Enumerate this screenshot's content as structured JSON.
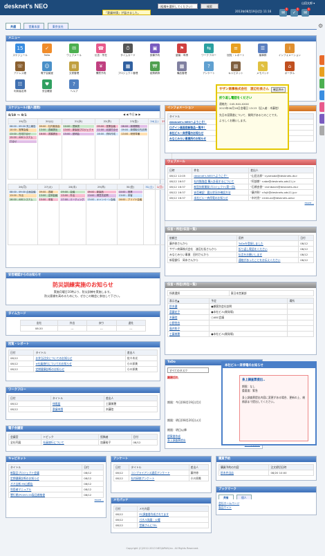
{
  "app": {
    "logo": "desknet's NEO",
    "notice": "「稟議申請」が届きました。",
    "search_placeholder": "(組織を選択してください)",
    "search_button": "検索",
    "datetime": "2013年08月19日(月) 11:16",
    "user": "山田太郎 ▾"
  },
  "top_badges": [
    "1",
    "1",
    "1"
  ],
  "tabs": [
    "共通",
    "営業本部",
    "東京支社"
  ],
  "menu": {
    "title": "メニュー",
    "items": [
      {
        "label": "スケジュール",
        "color": "#3a8de0",
        "glyph": "15"
      },
      {
        "label": "ToDo",
        "color": "#f08c2a",
        "glyph": "✓"
      },
      {
        "label": "ウェブメール",
        "color": "#4caf50",
        "glyph": "✉"
      },
      {
        "label": "伝言・所在",
        "color": "#e85a8c",
        "glyph": "☎"
      },
      {
        "label": "タイムカード",
        "color": "#555",
        "glyph": "⏱"
      },
      {
        "label": "設備予約",
        "color": "#7a5cc0",
        "glyph": "▣"
      },
      {
        "label": "稟議・申請",
        "color": "#d04040",
        "glyph": "⚑"
      },
      {
        "label": "ワークフロー",
        "color": "#2aa0a0",
        "glyph": "⇆"
      },
      {
        "label": "回覧・レポート",
        "color": "#e8a020",
        "glyph": "≡"
      },
      {
        "label": "議事録",
        "color": "#5a7fc0",
        "glyph": "☰"
      },
      {
        "label": "インフォメーション",
        "color": "#e09030",
        "glyph": "i"
      },
      {
        "label": "アドレス帳",
        "color": "#8a6030",
        "glyph": "☏"
      },
      {
        "label": "電子会議室",
        "color": "#4a90c8",
        "glyph": "☺"
      },
      {
        "label": "文書管理",
        "color": "#c0a040",
        "glyph": "▤"
      },
      {
        "label": "購買予約",
        "color": "#c04080",
        "glyph": "¥"
      },
      {
        "label": "プロジェクト管理",
        "color": "#3060a0",
        "glyph": "▦"
      },
      {
        "label": "経費精算",
        "color": "#50a050",
        "glyph": "₩"
      },
      {
        "label": "備品管理",
        "color": "#8080a0",
        "glyph": "▩"
      },
      {
        "label": "アンケート",
        "color": "#60a0d0",
        "glyph": "?"
      },
      {
        "label": "キャビネット",
        "color": "#806040",
        "glyph": "▥"
      },
      {
        "label": "メモパッド",
        "color": "#e0c040",
        "glyph": "✎"
      },
      {
        "label": "ポータル",
        "color": "#c05020",
        "glyph": "⌂"
      },
      {
        "label": "利用者名簿",
        "color": "#4070b0",
        "glyph": "☷"
      },
      {
        "label": "安否確認",
        "color": "#30a060",
        "glyph": "♥"
      },
      {
        "label": "ヘルプ",
        "color": "#5080c0",
        "glyph": "?"
      }
    ]
  },
  "schedule": {
    "title": "スケジュール(個人週間)",
    "range": "8/19 ～ 9/1",
    "week1_dates": [
      "19(月)",
      "20(火)",
      "21(水)",
      "22(木)",
      "23(金)",
      "24(土)",
      "25(日)"
    ],
    "week2_dates": [
      "26(月)",
      "27(火)",
      "28(水)",
      "29(木)",
      "30(金)",
      "31(土)",
      "1(日)"
    ],
    "w1": [
      [
        "08:00 - 09:00 売上報告",
        "10:00 - 営業会議",
        "13:00 - 在宅打合せ",
        "15:00 - ABCシステム",
        "打合せ"
      ],
      [
        "09:00 - 社内勉強会",
        "13:00 - 週報提出",
        "16:00 - 書類提出"
      ],
      [
        "10:00 - 提案書",
        "13:00 - 新製品プロジェクト",
        "15:00 - 説明会"
      ],
      [
        "09:00 - 営業会議",
        "11:00 - 北部打合せ",
        "16:00 - 資料作成"
      ],
      [
        "08:00 - 新規開拓",
        "09:00 - 新規取引先訪問",
        "13:00 - 研修準備"
      ],
      [],
      []
    ],
    "w2": [
      [
        "08:00 - 09:00 企画会議",
        "13:00 - 外出",
        "16:00 - ABCシステム"
      ],
      [
        "09:00 - 週報",
        "13:00 - 定例会議",
        "15:00 - 来客"
      ],
      [
        "09:00 - 会議",
        "13:00 - 外出",
        "17:00 - ミーティング"
      ],
      [
        "09:00 - 新製品",
        "13:00 - 得意先訪問",
        "15:00 - キャンペーン会議"
      ],
      [
        "10:00 - 営業",
        "13:00 - 来客",
        "16:00 - アリゾナ会議"
      ],
      [],
      []
    ]
  },
  "information": {
    "title": "インフォメーション",
    "col_title": "タイトル",
    "items": [
      [
        "desknet's NEOへようこそ！",
        ""
      ],
      [
        "ログイン画面用新製品一覧中！",
        ""
      ],
      [
        "本社ビル一斉停電のお知らせ",
        ""
      ],
      [
        "みなとみらい事業所のお知らせ",
        "小川(総務)[人事検査部]"
      ]
    ]
  },
  "popup": {
    "title": "サザン商事株式会社　渡辺社長さん",
    "button": "確認済み",
    "alert": "折り返し電話をください",
    "phone": "連絡先：045-940-XXXX",
    "detail": "2013年08月16日金曜日 13:23（記入者：木藤陸）",
    "body": "先日の見積書について、質問があるとのことです。",
    "body2": "よろしくお願いします。"
  },
  "webmail": {
    "title": "ウェブメール",
    "headers": [
      "日時",
      "件名",
      "差出人"
    ],
    "rows": [
      [
        "08/12 12:05",
        "desknet's NEOへようこそ！",
        "\"山田太郎\" <yamada@desknets.ds>"
      ],
      [
        "08/12 16:57",
        "社内勉強会 購入計画するについて",
        "\"阿部朗\" <abe@desknets.ods11.j>"
      ],
      [
        "08/12 16:37",
        "新型技術開発プロジェクト(第一回)",
        "\"石橋由香\" <ishibashi@desknets.ds>"
      ],
      [
        "08/12 16:37",
        "安否確認：震災状況の確認方法",
        "\"藤井幹\" <fujii@desknets.ods11.jp>"
      ],
      [
        "08/12 16:37",
        "本社ビル一斉停電のお知らせ",
        "\"木村貴\" <kimura@desknets.ods>"
      ]
    ],
    "more": "more..."
  },
  "messages": {
    "title": "伝言・所在(伝言一覧)",
    "headers": [
      "依頼主",
      "用件",
      "日付"
    ],
    "rows": [
      [
        "藤井修さんから",
        "ToDoを登録しました",
        "08/12"
      ],
      [
        "サザン商事株式会社　渡辺社長さんから",
        "折り返し電話をください",
        "08/12"
      ],
      [
        "みなとみらい事業　田村さんから",
        "伝言をお願いします",
        "08/12"
      ],
      [
        "新宿銀行　岡本さんから",
        "連絡があったことをお伝えください",
        "08/12"
      ]
    ]
  },
  "presence": {
    "title": "伝言・所在(所在一覧)",
    "tabs": [
      "所属選択",
      "東日本営業部"
    ],
    "headers": [
      "表示名▲",
      "予定",
      "場所"
    ],
    "rows": [
      [
        "鈴木健",
        "●顧客別会社訪問"
      ],
      [
        "斎藤花子",
        "●本社ビル(開発場)"
      ],
      [
        "木藤陸",
        "○ABC会議"
      ],
      [
        "小野悦也",
        ""
      ],
      [
        "島井和子",
        ""
      ],
      [
        "工藤美穂",
        "●本社ビル(開発場)"
      ]
    ]
  },
  "todo": {
    "title": "ToDo",
    "filter": "すべてのタスク",
    "overdue": "期限切れ",
    "items": [
      {
        "label": "期限：今日[08月19日(月)]",
        "date": "08/19"
      },
      {
        "label": "期限：明日[08月20日(火)]",
        "date": "08/20"
      },
      {
        "label": "期限：明日以降",
        "date": ""
      }
    ],
    "task": "提案書作成",
    "task2": "新規",
    "task3": "身上調査票提出",
    "all": "すべてを表示"
  },
  "bluepopup": {
    "header": "本社ビル一斉停電のお知らせ",
    "body": "身上調査票提出..",
    "sub": "期限：なし",
    "sub2": "重要度：緊急",
    "text": "身上調査票提出内容に変更がある場合、更新の上、総務部まで提出してください。"
  },
  "safety": {
    "title": "安否確認からのお知らせ",
    "headline": "防災訓練実施のお知らせ",
    "line1": "実施月曜日10時より、防災訓練を実施します。",
    "line2": "防災意識を高めるためにも、ぜひこの機会に参加して下さい。"
  },
  "timecard": {
    "title": "タイムカード",
    "headers": [
      "出社",
      "外出",
      "戻り",
      "退社"
    ],
    "values": [
      "08:20",
      "---",
      "---",
      "---"
    ]
  },
  "circular": {
    "title": "回覧・レポート",
    "headers": [
      "日付",
      "タイトル",
      "差出人"
    ],
    "rows": [
      [
        "08/12",
        "お弁当注文についてのお知らせ",
        "佐々木光"
      ],
      [
        "08/12",
        "※社員旅行についてのお知らせ",
        "小川邦美"
      ],
      [
        "08/12",
        "定期健康診断のお知らせ",
        "小川邦美"
      ]
    ]
  },
  "workflow": {
    "title": "ワークフロー",
    "headers": [
      "日付",
      "タイトル",
      "差出人"
    ],
    "rows": [
      [
        "08/12",
        "休暇届",
        "工藤美穂"
      ],
      [
        "08/12",
        "稟議申請",
        "木藤陸"
      ]
    ]
  },
  "forum": {
    "title": "電子会議室",
    "headers": [
      "会議室",
      "トピック",
      "投稿者",
      "日付"
    ],
    "rows": [
      [
        "全社円展",
        "社員旅行について",
        "加藤裕子",
        "08/12"
      ]
    ]
  },
  "cabinet": {
    "title": "キャビネット",
    "headers": [
      "タイトル",
      "日付"
    ],
    "rows": [
      [
        "新製品プロジェクト会議",
        "08/12"
      ],
      [
        "定期健康診断のお知らせ",
        "08/12"
      ],
      [
        "オオ吉新 Mt山都店",
        "08/12"
      ],
      [
        "利用者マニュアル",
        "08/12"
      ],
      [
        "懇行期(P0093-55製品規格書",
        "08/12"
      ]
    ],
    "more": "more..."
  },
  "survey": {
    "title": "アンケート",
    "headers": [
      "日付",
      "タイトル",
      "差出人"
    ],
    "rows": [
      [
        "08/12",
        "コンプライアンス違反アンケート",
        "藤井修"
      ],
      [
        "08/12",
        "社内研修アンケート",
        "小川邦美"
      ]
    ]
  },
  "equipment": {
    "title": "購買予約",
    "headers": [
      "購買予約の内容",
      "注文締切日時"
    ],
    "rows": [
      [
        "鈴木弁当店",
        "08/20 10:00"
      ]
    ]
  },
  "memo": {
    "title": "メモパッド",
    "headers": [
      "日付",
      "メモ内容"
    ],
    "rows": [
      [
        "08/12",
        "PC調査書作成されてます"
      ],
      [
        "08/12",
        "パネル発展：火曜"
      ],
      [
        "08/12",
        "営業さんにTEL"
      ]
    ]
  },
  "bookmark": {
    "title": "ブックマーク",
    "tabs": [
      "共有",
      "個人"
    ],
    "items": [
      "会社ホームページ",
      "製品サイト"
    ]
  },
  "footer": "Copyright (C)2012-2013 NEOJAPAN,Inc. All Rights Reserved."
}
